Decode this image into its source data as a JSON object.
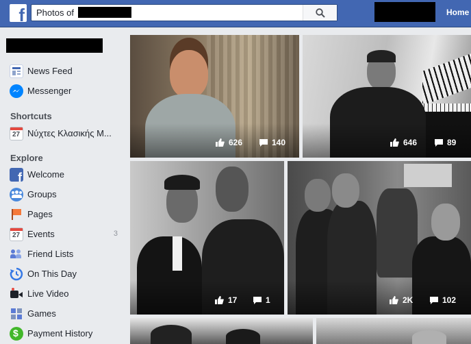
{
  "header": {
    "search_prefix": "Photos of",
    "home_label": "Home"
  },
  "sidebar": {
    "items": [
      {
        "label": "News Feed",
        "icon": "news-feed-icon"
      },
      {
        "label": "Messenger",
        "icon": "messenger-icon"
      }
    ],
    "shortcuts_title": "Shortcuts",
    "shortcuts": [
      {
        "label": "Νύχτες Κλασικής Μ...",
        "icon": "calendar-icon",
        "icon_text": "27"
      }
    ],
    "explore_title": "Explore",
    "explore": [
      {
        "label": "Welcome",
        "icon": "facebook-icon"
      },
      {
        "label": "Groups",
        "icon": "groups-icon"
      },
      {
        "label": "Pages",
        "icon": "pages-flag-icon"
      },
      {
        "label": "Events",
        "icon": "calendar-icon",
        "icon_text": "27",
        "count": "3"
      },
      {
        "label": "Friend Lists",
        "icon": "friend-lists-icon"
      },
      {
        "label": "On This Day",
        "icon": "on-this-day-icon"
      },
      {
        "label": "Live Video",
        "icon": "live-video-icon"
      },
      {
        "label": "Games",
        "icon": "games-icon"
      },
      {
        "label": "Payment History",
        "icon": "payment-history-icon"
      }
    ]
  },
  "photos": [
    {
      "likes": "626",
      "comments": "140"
    },
    {
      "likes": "646",
      "comments": "89"
    },
    {
      "likes": "17",
      "comments": "1"
    },
    {
      "likes": "2K",
      "comments": "102"
    }
  ],
  "colors": {
    "brand": "#4267b2",
    "background": "#e9ebee"
  }
}
